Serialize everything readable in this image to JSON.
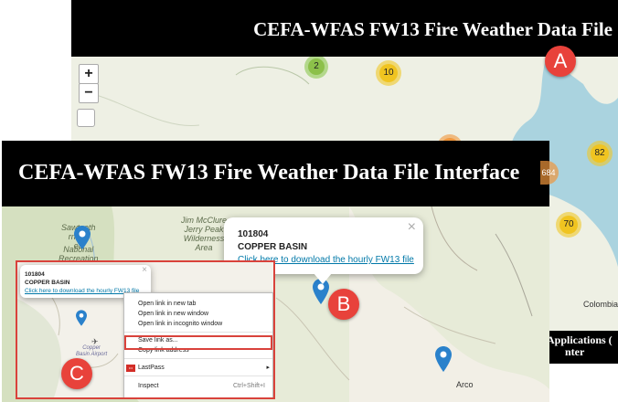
{
  "window_a": {
    "title": "CEFA-WFAS FW13 Fire Weather Data File",
    "zoom_in": "+",
    "zoom_out": "−",
    "clusters": [
      "2",
      "10",
      "82",
      "684",
      "70"
    ],
    "footer_line1": "Applications (",
    "footer_line2": "nter",
    "map_labels": {
      "colombia": "Colombia"
    }
  },
  "window_b": {
    "title": "CEFA-WFAS FW13 Fire Weather Data File Interface",
    "map_labels": {
      "sawtooth": "Sawtooth\nrness\nea",
      "national": "National\nRecreation\nArea",
      "jim_mcclure": "Jim McClure\nJerry Peak\nWilderness\nArea",
      "arco": "Arco",
      "copper_basin_airport": "Copper\nBasin Airport"
    },
    "popup": {
      "close": "×",
      "id": "101804",
      "name": "COPPER BASIN",
      "link": "Click here to download the hourly FW13 file"
    },
    "inset": {
      "popup": {
        "close": "×",
        "id": "101804",
        "name": "COPPER BASIN",
        "link": "Click here to download the hourly FW13 file"
      },
      "context_menu": {
        "items": [
          "Open link in new tab",
          "Open link in new window",
          "Open link in incognito window",
          "Save link as...",
          "Copy link address",
          "LastPass",
          "Inspect"
        ],
        "lastpass_icon_text": "•••",
        "inspect_shortcut": "Ctrl+Shift+I",
        "submenu_arrow": "▸"
      }
    }
  },
  "annotations": {
    "a": "A",
    "b": "B",
    "c": "C"
  },
  "colors": {
    "badge": "#e8423b",
    "highlight": "#d9423b",
    "marker": "#2a81cb",
    "link": "#0078a8"
  }
}
